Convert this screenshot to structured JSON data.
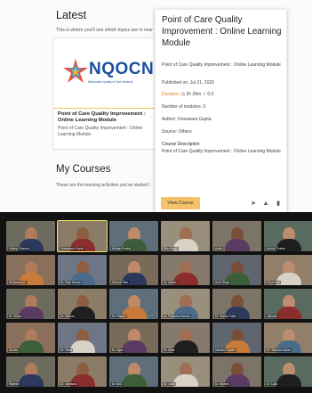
{
  "latest": {
    "title": "Latest",
    "subtitle": "This is where you'll see which topics are in new"
  },
  "course_card": {
    "logo_text": "NQOCN",
    "logo_tagline": "Nationwide Quality of Care Network",
    "title": "Point of Care Quality Improvement : Online Learning Module",
    "description": "Point of Care Quality Improvement : Online Learning Module"
  },
  "my_courses": {
    "title": "My Courses",
    "subtitle": "These are the learning activities you've started l"
  },
  "popup": {
    "title": "Point of Care Quality Improvement : Online Learning Module",
    "description_short": "Point of Care Quality Improvement : Online Learning Module",
    "published": "Published on: Jul 21, 2020",
    "duration_label": "Duration:",
    "duration_value": "2h 28m",
    "rating": "0.0",
    "modules": "Number of modules: 3",
    "author": "Author: Viveswara Gupta",
    "source": "Source: Others",
    "course_desc_label": "Course Description",
    "course_desc": "Point of Care Quality Improvement : Online Learning Module",
    "view_button": "View Course",
    "icons": [
      "share-icon",
      "thumbs-up-icon",
      "bookmark-icon"
    ]
  },
  "gallery": {
    "participants": [
      {
        "name": "Vishnu Sharma"
      },
      {
        "name": "Viveswara Gupta"
      },
      {
        "name": "Mohan Reddy"
      },
      {
        "name": "Ritu Singh"
      },
      {
        "name": "Anita"
      },
      {
        "name": "Ashok Thakur"
      },
      {
        "name": "Mohammad I"
      },
      {
        "name": "Dr. Ravi Kumar"
      },
      {
        "name": "Suresh Rao"
      },
      {
        "name": "Dr. Kavita"
      },
      {
        "name": "Amit Singh"
      },
      {
        "name": "Priya Nair"
      },
      {
        "name": "Dr. Shilpa"
      },
      {
        "name": "Dr. Meena"
      },
      {
        "name": "Dr. Rajesh"
      },
      {
        "name": "Dr. Pratibha Kumari"
      },
      {
        "name": "Dr. Sunita Patel"
      },
      {
        "name": "Jitendra"
      },
      {
        "name": "Sunita"
      },
      {
        "name": "Dr. Neha"
      },
      {
        "name": "Dr. Arjun"
      },
      {
        "name": "Dr. Kiran"
      },
      {
        "name": "Harsha Tripathi"
      },
      {
        "name": "Dr. Shweta Yadav"
      },
      {
        "name": "Rakesh"
      },
      {
        "name": "Dr. Vandana"
      },
      {
        "name": "Dr. Anil"
      },
      {
        "name": "Dr. Usha"
      },
      {
        "name": "Dr. Mohan"
      },
      {
        "name": "Dr. Lata"
      }
    ]
  }
}
